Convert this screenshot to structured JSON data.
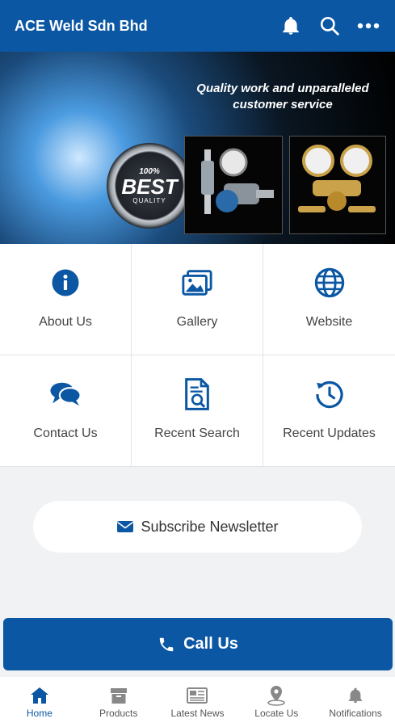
{
  "header": {
    "title": "ACE Weld Sdn Bhd",
    "actions": [
      {
        "icon": "bell-icon"
      },
      {
        "icon": "search-icon"
      },
      {
        "icon": "more-icon"
      }
    ]
  },
  "banner": {
    "tagline": "Quality work and unparalleled customer service",
    "badge": {
      "line1": "100%",
      "line2": "BEST",
      "line3": "QUALITY"
    }
  },
  "menu": [
    {
      "label": "About Us",
      "icon": "info-icon"
    },
    {
      "label": "Gallery",
      "icon": "gallery-icon"
    },
    {
      "label": "Website",
      "icon": "globe-icon"
    },
    {
      "label": "Contact Us",
      "icon": "chat-icon"
    },
    {
      "label": "Recent Search",
      "icon": "document-search-icon"
    },
    {
      "label": "Recent Updates",
      "icon": "history-icon"
    }
  ],
  "subscribe": {
    "label": "Subscribe Newsletter",
    "icon": "envelope-icon"
  },
  "call": {
    "label": "Call Us",
    "icon": "phone-icon"
  },
  "bottom_nav": [
    {
      "label": "Home",
      "icon": "home-icon",
      "active": true
    },
    {
      "label": "Products",
      "icon": "box-icon"
    },
    {
      "label": "Latest News",
      "icon": "newspaper-icon"
    },
    {
      "label": "Locate Us",
      "icon": "location-pin-icon"
    },
    {
      "label": "Notifications",
      "icon": "bell-icon"
    }
  ],
  "colors": {
    "primary": "#0b57a4",
    "background": "#f1f2f3",
    "nav_inactive": "#888888"
  }
}
